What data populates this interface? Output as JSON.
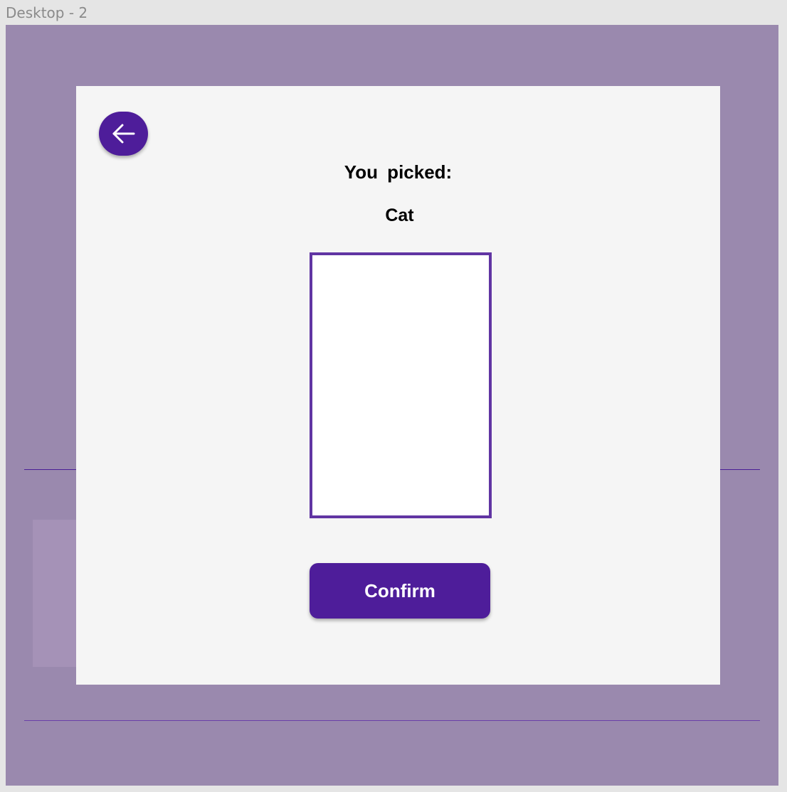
{
  "frame": {
    "label": "Desktop - 2"
  },
  "modal": {
    "back_icon": "arrow-left-icon",
    "title": "You picked:",
    "choice": "Cat",
    "confirm_label": "Confirm"
  },
  "colors": {
    "accent": "#4e1d9a",
    "image_border": "#6135a3",
    "backdrop": "#9a89ae",
    "modal_bg": "#f5f5f5"
  }
}
